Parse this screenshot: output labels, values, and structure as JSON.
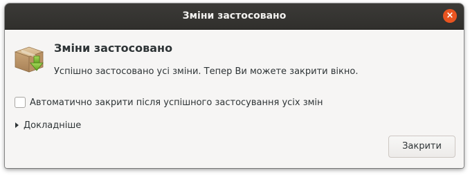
{
  "window": {
    "title": "Зміни застосовано"
  },
  "titlebar": {
    "close_glyph": "×",
    "close_color": "#e95420"
  },
  "dialog": {
    "icon": "package-install-icon",
    "heading": "Зміни застосовано",
    "message": "Успішно застосовано усі зміни. Тепер Ви можете закрити вікно.",
    "auto_close_checkbox": {
      "label": "Автоматично закрити після успішного застосування усіх змін",
      "checked": false
    },
    "details_expander": {
      "label": "Докладніше",
      "expanded": false
    },
    "close_button_label": "Закрити"
  }
}
